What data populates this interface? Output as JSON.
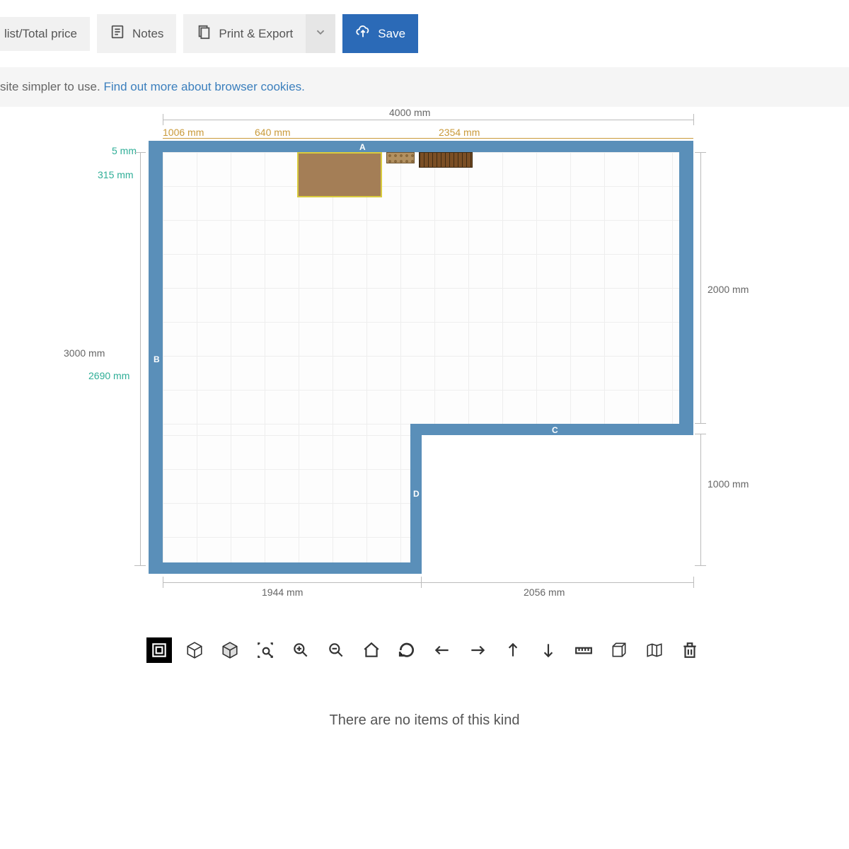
{
  "toolbar": {
    "list_price": "list/Total price",
    "notes": "Notes",
    "print_export": "Print & Export",
    "save": "Save"
  },
  "cookie_bar": {
    "text_before": "site simpler to use. ",
    "link_text": "Find out more about browser cookies."
  },
  "dimensions": {
    "top_total": "4000 mm",
    "seg_a": "1006 mm",
    "seg_b": "640 mm",
    "seg_c": "2354 mm",
    "left_total": "3000 mm",
    "left_small": "5 mm",
    "left_mid": "315 mm",
    "left_inner": "2690 mm",
    "right_a": "2000 mm",
    "right_b": "1000 mm",
    "bottom_a": "1944 mm",
    "bottom_b": "2056 mm"
  },
  "walls": {
    "a": "A",
    "b": "B",
    "c": "C",
    "d": "D"
  },
  "empty_message": "There are no items of this kind"
}
